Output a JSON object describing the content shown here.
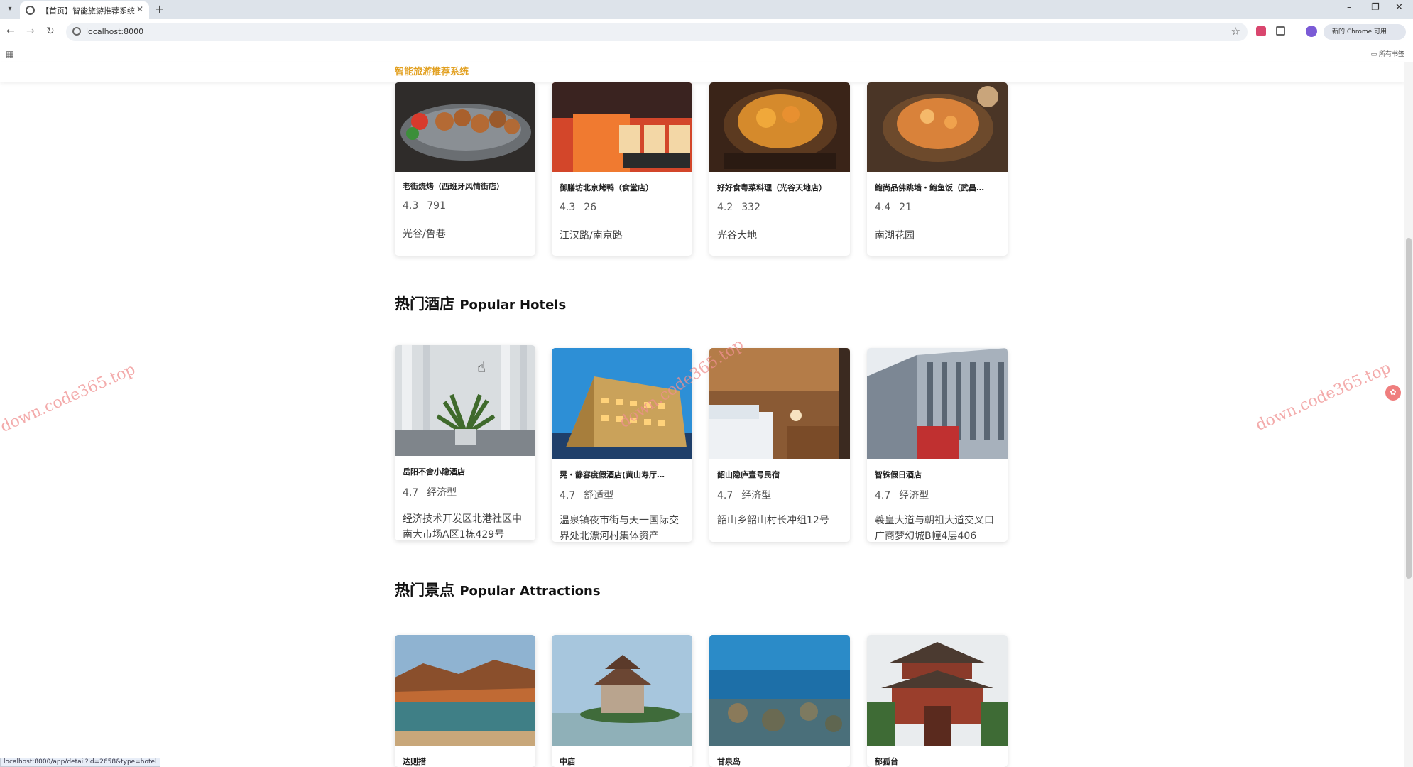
{
  "browser": {
    "tab_title": "【首页】智能旅游推荐系统",
    "tab_close": "✕",
    "new_tab": "+",
    "scroll_arrow": "▾",
    "url": "localhost:8000",
    "profile_label": "新的 Chrome 可用",
    "bookmarks_folder": "所有书签",
    "minimize": "–",
    "maximize": "❐",
    "close": "✕",
    "status_url": "localhost:8000/app/detail?id=2658&type=hotel"
  },
  "site": {
    "logo": "智能旅游推荐系统"
  },
  "food": {
    "cards": [
      {
        "name": "老街烧烤（西班牙风情街店）",
        "rating": "4.3",
        "count": "791",
        "area": "光谷/鲁巷"
      },
      {
        "name": "御膳坊北京烤鸭（食堂店）",
        "rating": "4.3",
        "count": "26",
        "area": "江汉路/南京路"
      },
      {
        "name": "好好食粤菜料理（光谷天地店）",
        "rating": "4.2",
        "count": "332",
        "area": "光谷大地"
      },
      {
        "name": "鲍尚品佛跳墙・鲍鱼饭（武昌…",
        "rating": "4.4",
        "count": "21",
        "area": "南湖花园"
      }
    ]
  },
  "hotels": {
    "title_cn": "热门酒店",
    "title_en": "Popular Hotels",
    "cards": [
      {
        "name": "岳阳不舍小隐酒店",
        "rating": "4.7",
        "type": "经济型",
        "address": "经济技术开发区北港社区中南大市场A区1栋429号"
      },
      {
        "name": "晃・静容度假酒店(黄山寿厅…",
        "rating": "4.7",
        "type": "舒适型",
        "address": "温泉镇夜市街与天一国际交界处北漂河村集体资产"
      },
      {
        "name": "韶山隐庐壹号民宿",
        "rating": "4.7",
        "type": "经济型",
        "address": "韶山乡韶山村长冲组12号"
      },
      {
        "name": "智铢假日酒店",
        "rating": "4.7",
        "type": "经济型",
        "address": "羲皇大道与朝祖大道交叉口广商梦幻城B幢4层406"
      }
    ]
  },
  "attractions": {
    "title_cn": "热门景点",
    "title_en": "Popular Attractions",
    "cards": [
      {
        "name": "达则措"
      },
      {
        "name": "中庙"
      },
      {
        "name": "甘泉岛"
      },
      {
        "name": "郁孤台"
      }
    ]
  },
  "watermark": "down.code365.top",
  "colors": {
    "accent": "#e2a020",
    "watermark": "#f09090",
    "tabbar": "#dde3ea"
  }
}
